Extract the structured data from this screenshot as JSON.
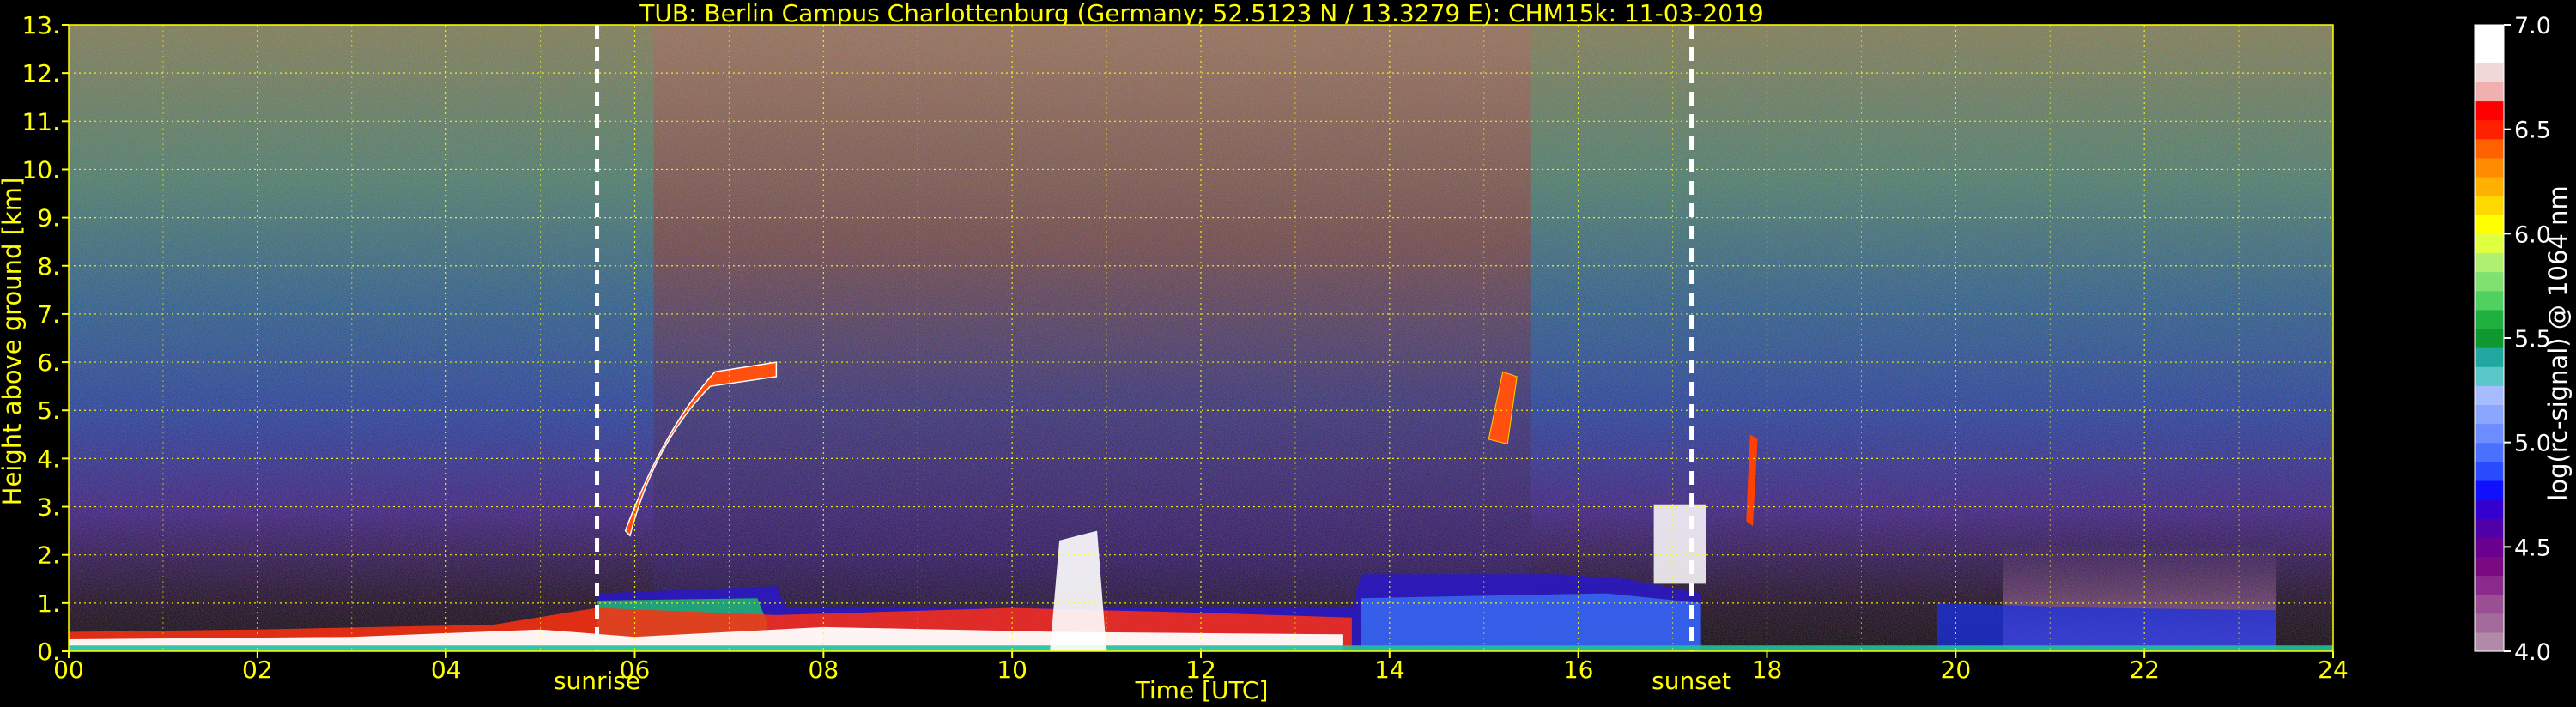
{
  "chart_data": {
    "type": "heatmap",
    "title": "TUB: Berlin Campus Charlottenburg (Germany; 52.5123 N / 13.3279 E):    CHM15k: 11-03-2019",
    "xlabel": "Time [UTC]",
    "ylabel": "Height above ground [km]",
    "xlim": [
      0,
      24
    ],
    "ylim": [
      0,
      13
    ],
    "x_ticks": [
      0,
      2,
      4,
      6,
      8,
      10,
      12,
      14,
      16,
      18,
      20,
      22,
      24
    ],
    "x_tick_labels": [
      "00",
      "02",
      "04",
      "06",
      "08",
      "10",
      "12",
      "14",
      "16",
      "18",
      "20",
      "22",
      "24"
    ],
    "y_ticks": [
      0,
      1,
      2,
      3,
      4,
      5,
      6,
      7,
      8,
      9,
      10,
      11,
      12,
      13
    ],
    "y_tick_labels": [
      "0.",
      "1.",
      "2.",
      "3.",
      "4.",
      "5.",
      "6.",
      "7.",
      "8.",
      "9.",
      "10.",
      "11.",
      "12.",
      "13."
    ],
    "grid": true,
    "events": [
      {
        "label": "sunrise",
        "time": 5.6
      },
      {
        "label": "sunset",
        "time": 17.2
      }
    ],
    "colorbar": {
      "label": "log(rc-signal) @ 1064 nm",
      "range": [
        4.0,
        7.0
      ],
      "ticks": [
        4.0,
        4.5,
        5.0,
        5.5,
        6.0,
        6.5,
        7.0
      ],
      "tick_labels": [
        "4.0",
        "4.5",
        "5.0",
        "5.5",
        "6.0",
        "6.5",
        "7.0"
      ],
      "colors": [
        "#b08aa6",
        "#a46a9c",
        "#9a4e94",
        "#8a2a8c",
        "#7a0a82",
        "#6a0090",
        "#5000a8",
        "#3400d0",
        "#1010ff",
        "#2a4cff",
        "#4a70ff",
        "#6c8cff",
        "#8aa6ff",
        "#a6bcff",
        "#5ac8c8",
        "#20a8a0",
        "#109830",
        "#20b040",
        "#50d060",
        "#80e070",
        "#b0f070",
        "#e0ff40",
        "#ffff00",
        "#ffd800",
        "#ffb000",
        "#ff8c00",
        "#ff6000",
        "#ff2000",
        "#ff0000",
        "#f0b0b0",
        "#f0d8d8",
        "#ffffff",
        "#ffffff"
      ]
    }
  }
}
